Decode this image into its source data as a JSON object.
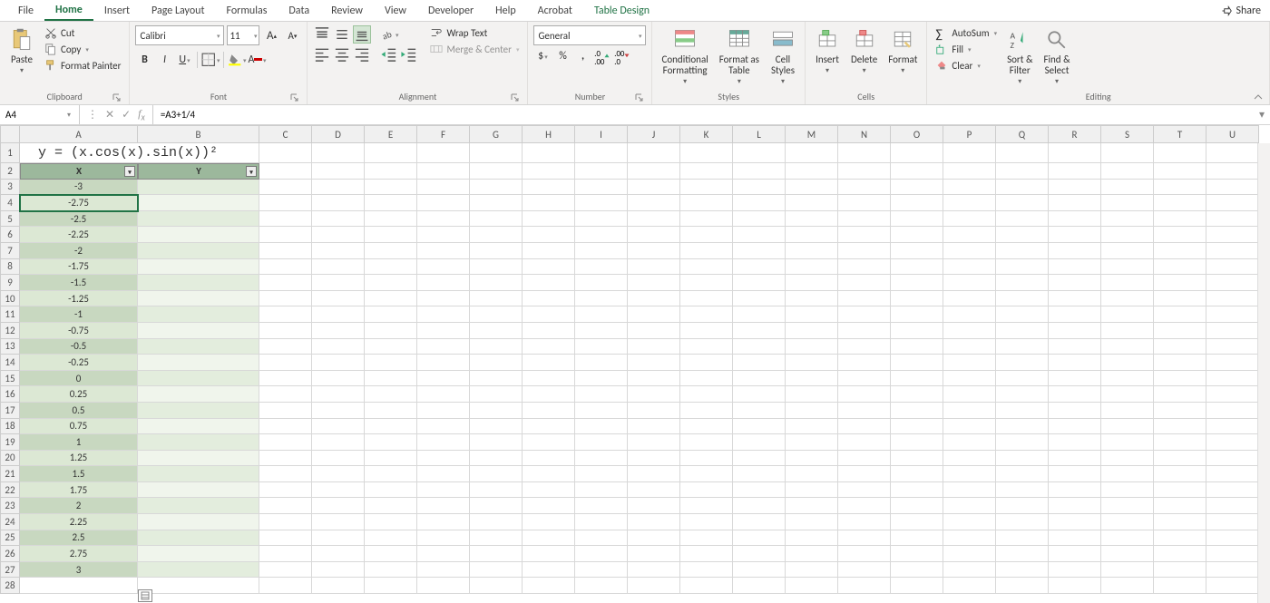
{
  "tabs": [
    "File",
    "Home",
    "Insert",
    "Page Layout",
    "Formulas",
    "Data",
    "Review",
    "View",
    "Developer",
    "Help",
    "Acrobat",
    "Table Design"
  ],
  "active_tab": "Home",
  "share_label": "Share",
  "clipboard": {
    "paste": "Paste",
    "cut": "Cut",
    "copy": "Copy",
    "fp": "Format Painter",
    "label": "Clipboard"
  },
  "font": {
    "name": "Calibri",
    "size": "11",
    "label": "Font"
  },
  "alignment": {
    "wrap": "Wrap Text",
    "merge": "Merge & Center",
    "label": "Alignment"
  },
  "number": {
    "format": "General",
    "label": "Number"
  },
  "styles": {
    "cf": "Conditional\nFormatting",
    "fat": "Format as\nTable",
    "cs": "Cell\nStyles",
    "label": "Styles"
  },
  "cells": {
    "insert": "Insert",
    "delete": "Delete",
    "format": "Format",
    "label": "Cells"
  },
  "editing": {
    "autosum": "AutoSum",
    "fill": "Fill",
    "clear": "Clear",
    "sort": "Sort &\nFilter",
    "find": "Find &\nSelect",
    "label": "Editing"
  },
  "namebox": "A4",
  "formula": "=A3+1/4",
  "columns": [
    "A",
    "B",
    "C",
    "D",
    "E",
    "F",
    "G",
    "H",
    "I",
    "J",
    "K",
    "L",
    "M",
    "N",
    "O",
    "P",
    "Q",
    "R",
    "S",
    "T",
    "U"
  ],
  "row1_merged": "y = (x.cos(x).sin(x))²",
  "table_headers": {
    "x": "X",
    "y": "Y"
  },
  "col_a_values": [
    "-3",
    "-2.75",
    "-2.5",
    "-2.25",
    "-2",
    "-1.75",
    "-1.5",
    "-1.25",
    "-1",
    "-0.75",
    "-0.5",
    "-0.25",
    "0",
    "0.25",
    "0.5",
    "0.75",
    "1",
    "1.25",
    "1.5",
    "1.75",
    "2",
    "2.25",
    "2.5",
    "2.75",
    "3"
  ],
  "row_count": 28,
  "selected_cell": "A4"
}
